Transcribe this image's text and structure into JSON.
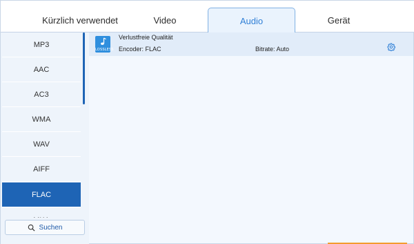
{
  "tabs": [
    {
      "label": "Kürzlich verwendet"
    },
    {
      "label": "Video"
    },
    {
      "label": "Audio"
    },
    {
      "label": "Gerät"
    }
  ],
  "active_tab": "Audio",
  "formats": [
    {
      "label": "MP3"
    },
    {
      "label": "AAC"
    },
    {
      "label": "AC3"
    },
    {
      "label": "WMA"
    },
    {
      "label": "WAV"
    },
    {
      "label": "AIFF"
    },
    {
      "label": "FLAC"
    },
    {
      "label": "MKA"
    }
  ],
  "selected_format": "FLAC",
  "search": {
    "label": "Suchen",
    "icon": "search-icon"
  },
  "preset": {
    "file_icon_label": "LOSSLESS",
    "quality": "Verlustfreie Qualität",
    "encoder": "Encoder: FLAC",
    "bitrate": "Bitrate: Auto",
    "settings_icon": "gear-icon"
  },
  "colors": {
    "accent": "#1e64b5",
    "tab_active_text": "#2f7fd6",
    "file_icon": "#2f8fde",
    "highlight": "#f39c2f"
  }
}
